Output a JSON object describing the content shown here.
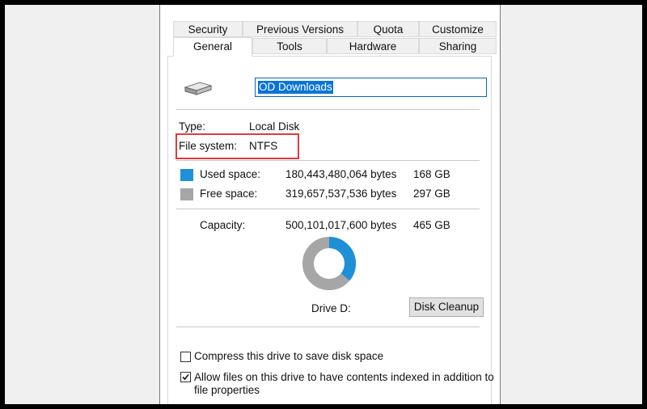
{
  "tabs_row1": [
    "Security",
    "Previous Versions",
    "Quota",
    "Customize"
  ],
  "tabs_row2": [
    "General",
    "Tools",
    "Hardware",
    "Sharing"
  ],
  "drive_icon": "drive-icon",
  "drive_name": "OD Downloads",
  "type": {
    "label": "Type:",
    "value": "Local Disk"
  },
  "file_system": {
    "label": "File system:",
    "value": "NTFS"
  },
  "used": {
    "label": "Used space:",
    "bytes": "180,443,480,064 bytes",
    "size": "168 GB",
    "color": "#1e90d8"
  },
  "free": {
    "label": "Free space:",
    "bytes": "319,657,537,536 bytes",
    "size": "297 GB",
    "color": "#a6a6a6"
  },
  "capacity": {
    "label": "Capacity:",
    "bytes": "500,101,017,600 bytes",
    "size": "465 GB"
  },
  "drive_label": "Drive D:",
  "disk_cleanup_label": "Disk Cleanup",
  "compress_label": "Compress this drive to save disk space",
  "index_label_line1": "Allow files on this drive to have contents indexed in addition to",
  "index_label_line2": "file properties",
  "compress_checked": false,
  "index_checked": true,
  "used_fraction": 0.36
}
